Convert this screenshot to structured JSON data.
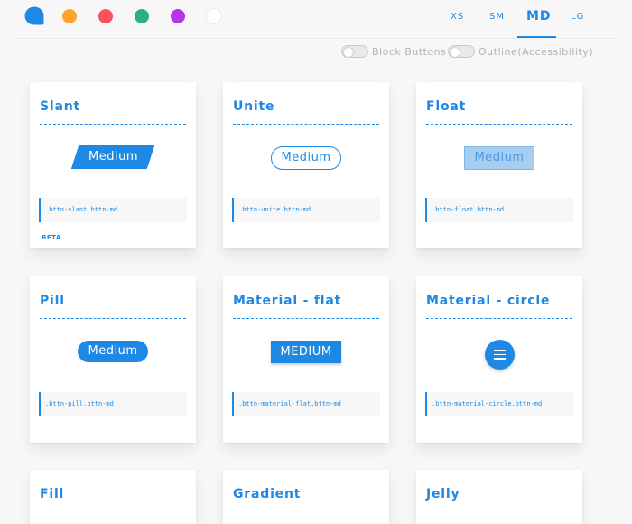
{
  "palette": {
    "colors": [
      "#1d89e4",
      "#fea32e",
      "#f9525f",
      "#2bb27a",
      "#b735e7",
      "#ffffff"
    ]
  },
  "sizes": {
    "items": [
      "XS",
      "SM",
      "MD",
      "LG"
    ],
    "active": "MD"
  },
  "toggles": {
    "block_buttons": "Block Buttons",
    "outline": "Outline(Accessibility)"
  },
  "cards": {
    "slant": {
      "title": "Slant",
      "button": "Medium",
      "code": ".bttn-slant.bttn-md",
      "badge": "BETA"
    },
    "unite": {
      "title": "Unite",
      "button": "Medium",
      "code": ".bttn-unite.bttn-md"
    },
    "float": {
      "title": "Float",
      "button": "Medium",
      "code": ".bttn-float.bttn-md"
    },
    "pill": {
      "title": "Pill",
      "button": "Medium",
      "code": ".bttn-pill.bttn-md"
    },
    "material_flat": {
      "title": "Material - flat",
      "button": "MEDIUM",
      "code": ".bttn-material-flat.bttn-md"
    },
    "material_circle": {
      "title": "Material - circle",
      "button_icon": "menu-icon",
      "code": ".bttn-material-circle.bttn-md"
    },
    "fill": {
      "title": "Fill"
    },
    "gradient": {
      "title": "Gradient"
    },
    "jelly": {
      "title": "Jelly"
    }
  }
}
